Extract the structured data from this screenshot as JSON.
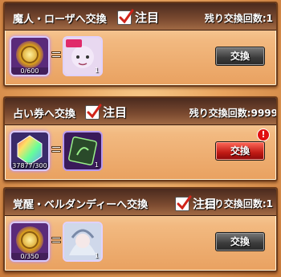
{
  "panels": [
    {
      "title": "魔人・ローザへ交換",
      "attention_label": "注目",
      "remaining": "残り交換回数:1",
      "source_count": "0/600",
      "dest_qty": "1",
      "button_label": "交換",
      "button_style": "gray",
      "has_alert": false
    },
    {
      "title": "占い券へ交換",
      "attention_label": "注目",
      "remaining": "残り交換回数:9999",
      "source_count": "37877/300",
      "dest_qty": "1",
      "button_label": "交換",
      "button_style": "red",
      "has_alert": true,
      "alert_glyph": "!"
    },
    {
      "title": "覚醒・ベルダンディーへ交換",
      "attention_label": "注目",
      "remaining": "残り交換回数:1",
      "source_count": "0/350",
      "dest_qty": "1",
      "button_label": "交換",
      "button_style": "gray",
      "has_alert": false
    }
  ],
  "colors": {
    "accent_red": "#c01a14",
    "check_red": "#d0241a",
    "panel_bg": "#f2b980",
    "title_bar": "#4a2a1e"
  }
}
